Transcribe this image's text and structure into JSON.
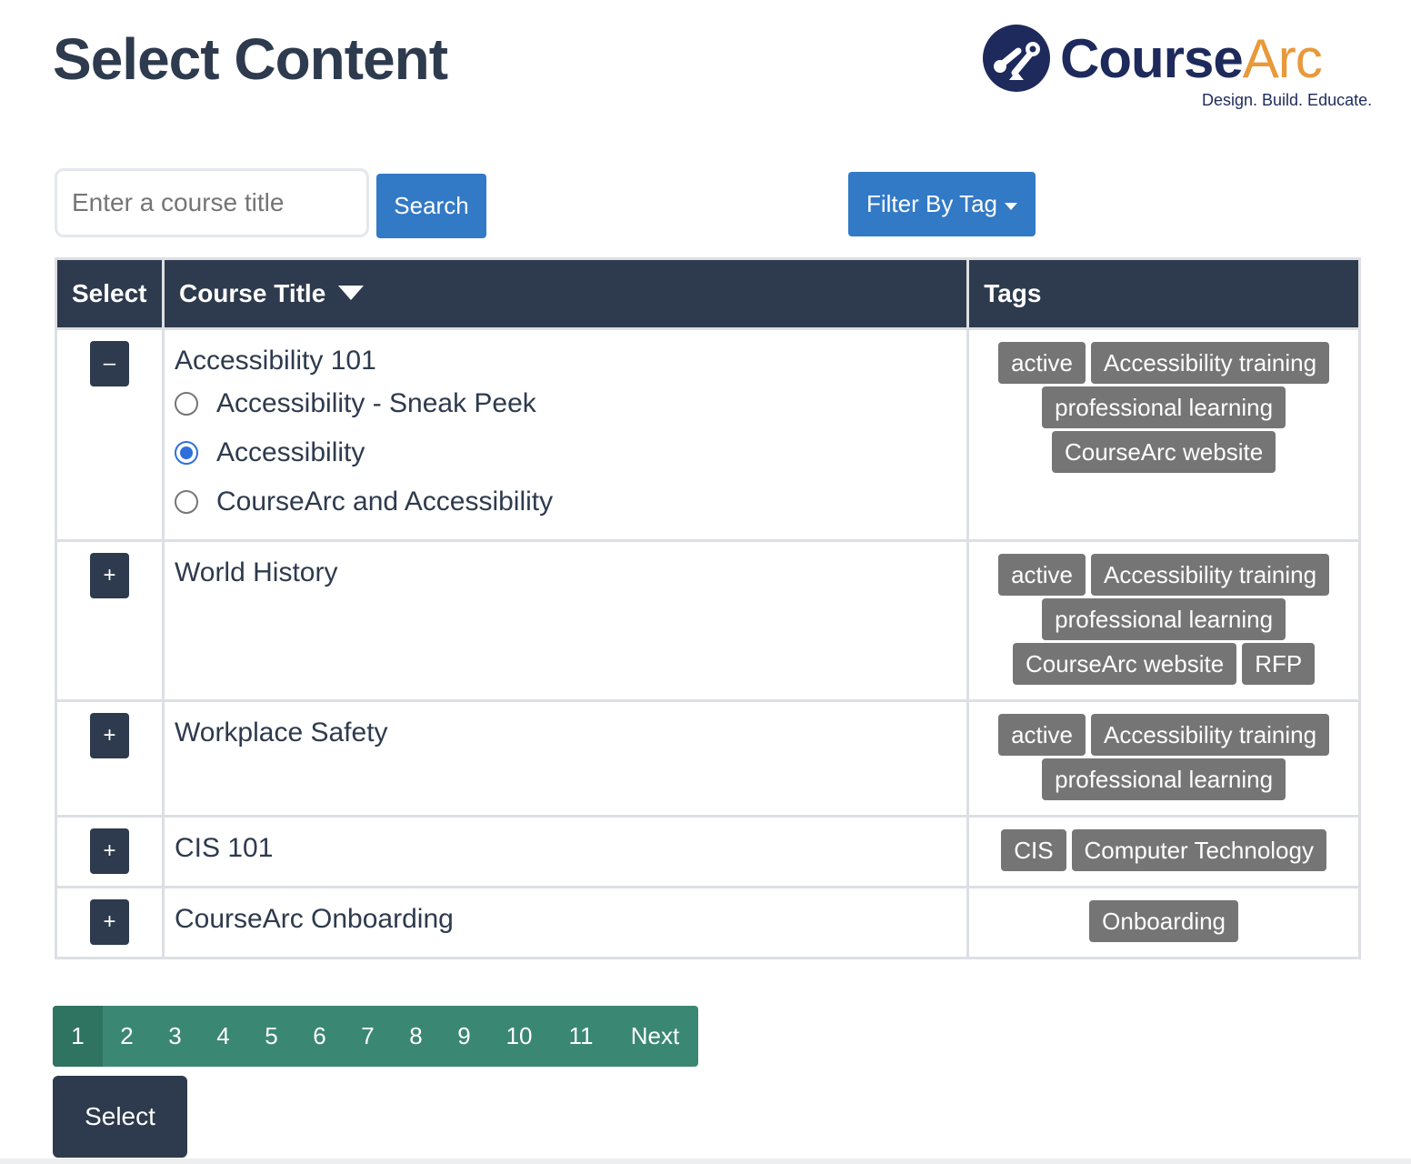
{
  "page": {
    "title": "Select Content"
  },
  "logo": {
    "name_main": "Course",
    "name_accent": "Arc",
    "tagline": "Design. Build. Educate."
  },
  "search": {
    "placeholder": "Enter a course title",
    "value": "",
    "button_label": "Search"
  },
  "filter": {
    "button_label": "Filter By Tag"
  },
  "table": {
    "headers": {
      "select": "Select",
      "title": "Course Title",
      "tags": "Tags"
    },
    "rows": [
      {
        "toggle": "–",
        "title": "Accessibility 101",
        "options": [
          {
            "label": "Accessibility - Sneak Peek",
            "checked": false
          },
          {
            "label": "Accessibility",
            "checked": true
          },
          {
            "label": "CourseArc and Accessibility",
            "checked": false
          }
        ],
        "tag_lines": [
          [
            "active",
            "Accessibility training"
          ],
          [
            "professional learning"
          ],
          [
            "CourseArc website"
          ]
        ]
      },
      {
        "toggle": "+",
        "title": "World History",
        "tag_lines": [
          [
            "active",
            "Accessibility training"
          ],
          [
            "professional learning"
          ],
          [
            "CourseArc website",
            "RFP"
          ]
        ]
      },
      {
        "toggle": "+",
        "title": "Workplace Safety",
        "tag_lines": [
          [
            "active",
            "Accessibility training"
          ],
          [
            "professional learning"
          ]
        ]
      },
      {
        "toggle": "+",
        "title": "CIS 101",
        "tag_lines": [
          [
            "CIS",
            "Computer Technology"
          ]
        ]
      },
      {
        "toggle": "+",
        "title": "CourseArc Onboarding",
        "tag_lines": [
          [
            "Onboarding"
          ]
        ]
      }
    ]
  },
  "pagination": {
    "pages": [
      "1",
      "2",
      "3",
      "4",
      "5",
      "6",
      "7",
      "8",
      "9",
      "10",
      "11"
    ],
    "current": "1",
    "next_label": "Next"
  },
  "actions": {
    "select_label": "Select"
  },
  "colors": {
    "header_bg": "#2e3a4d",
    "primary_blue": "#3279c6",
    "tag_gray": "#757575",
    "pagination_green": "#3a8773",
    "logo_navy": "#1e2a5c",
    "logo_orange": "#e8993a"
  }
}
